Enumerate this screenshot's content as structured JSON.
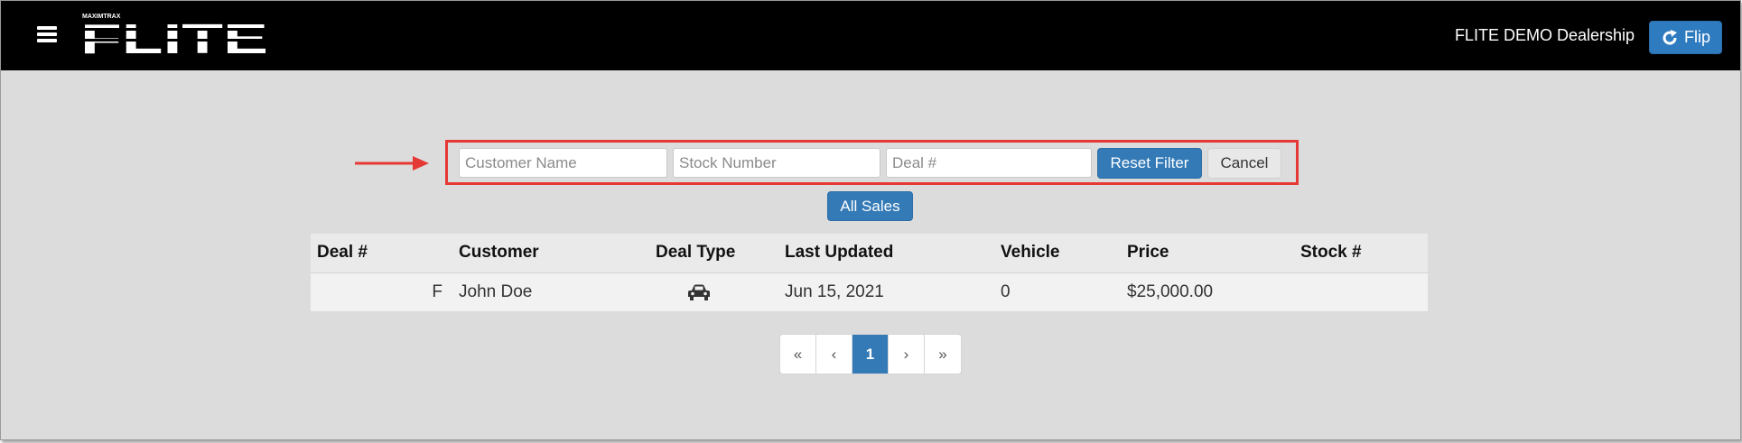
{
  "header": {
    "logo_text": "FLITE",
    "logo_tagline": "MAXIMTRAX",
    "dealership": "FLITE DEMO Dealership",
    "flip_label": "Flip",
    "colors": {
      "bar": "#000000",
      "flip_button": "#2f7bbf"
    }
  },
  "filters": {
    "customer_name_placeholder": "Customer Name",
    "stock_number_placeholder": "Stock Number",
    "deal_number_placeholder": "Deal #",
    "reset_label": "Reset Filter",
    "cancel_label": "Cancel",
    "highlight_color": "#e53935"
  },
  "all_sales_label": "All Sales",
  "table": {
    "headers": [
      "Deal #",
      "Customer",
      "Deal Type",
      "Last Updated",
      "Vehicle",
      "Price",
      "Stock #"
    ],
    "rows": [
      {
        "deal_number": "F",
        "customer": "John Doe",
        "deal_type_icon": "car-icon",
        "last_updated": "Jun 15, 2021",
        "vehicle": "0",
        "price": "$25,000.00",
        "stock_number": ""
      }
    ]
  },
  "pagination": {
    "first": "«",
    "prev": "‹",
    "current": "1",
    "next": "›",
    "last": "»"
  }
}
